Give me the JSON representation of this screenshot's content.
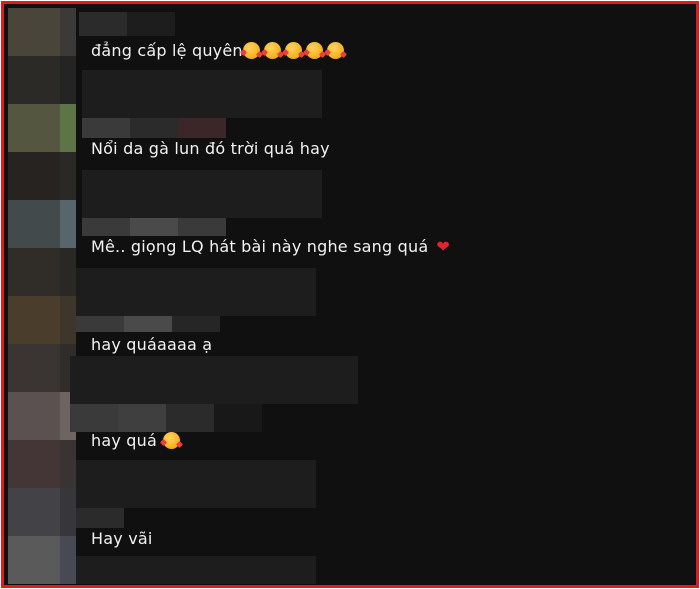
{
  "comments": [
    {
      "text": "đẳng cấp lệ quyên",
      "emoji": "smiling-face-with-hearts",
      "emoji_count": 5
    },
    {
      "text": "Nổi da gà lun đó trời quá hay"
    },
    {
      "text": "Mê.. giọng LQ hát bài này nghe sang quá",
      "emoji": "red-heart"
    },
    {
      "text": "hay quáaaaa ạ"
    },
    {
      "text": "hay quá",
      "emoji": "smiling-face-with-hearts",
      "emoji_count": 1
    },
    {
      "text": "Hay vãi"
    }
  ],
  "colors": {
    "frame_border": "#e21b1b",
    "background": "#101010",
    "text": "#f2f2f2",
    "heart": "#e0262d"
  }
}
